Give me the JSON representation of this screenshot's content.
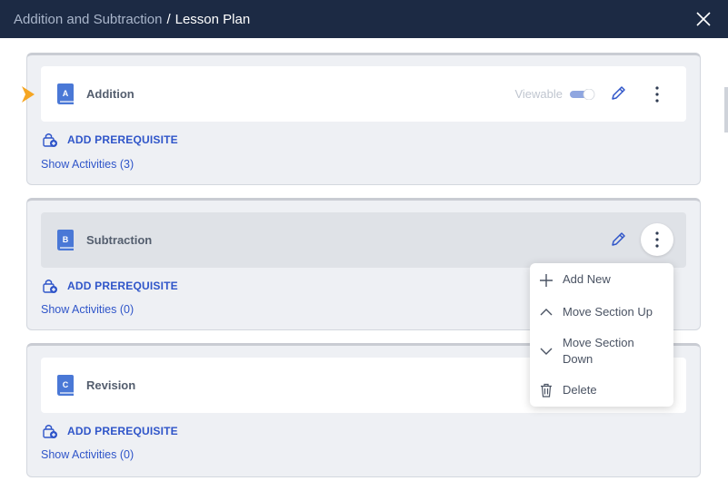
{
  "header": {
    "breadcrumb_parent": "Addition and Subtraction",
    "separator": "/",
    "breadcrumb_current": "Lesson Plan"
  },
  "sections": [
    {
      "badge": "A",
      "title": "Addition",
      "viewable_label": "Viewable",
      "viewable_on": true,
      "prerequisite_label": "ADD PREREQUISITE",
      "show_activities": "Show Activities (3)"
    },
    {
      "badge": "B",
      "title": "Subtraction",
      "prerequisite_label": "ADD PREREQUISITE",
      "show_activities": "Show Activities (0)"
    },
    {
      "badge": "C",
      "title": "Revision",
      "prerequisite_label": "ADD PREREQUISITE",
      "show_activities": "Show Activities (0)"
    }
  ],
  "context_menu": {
    "items": [
      {
        "label": "Add New",
        "icon": "plus-icon"
      },
      {
        "label": "Move Section Up",
        "icon": "chevron-up-icon"
      },
      {
        "label": "Move Section Down",
        "icon": "chevron-down-icon"
      },
      {
        "label": "Delete",
        "icon": "trash-icon"
      }
    ]
  },
  "colors": {
    "header_bg": "#1c2a44",
    "accent_blue": "#2f55c9",
    "book_blue": "#4a78d6",
    "pointer_orange": "#f5a623"
  }
}
